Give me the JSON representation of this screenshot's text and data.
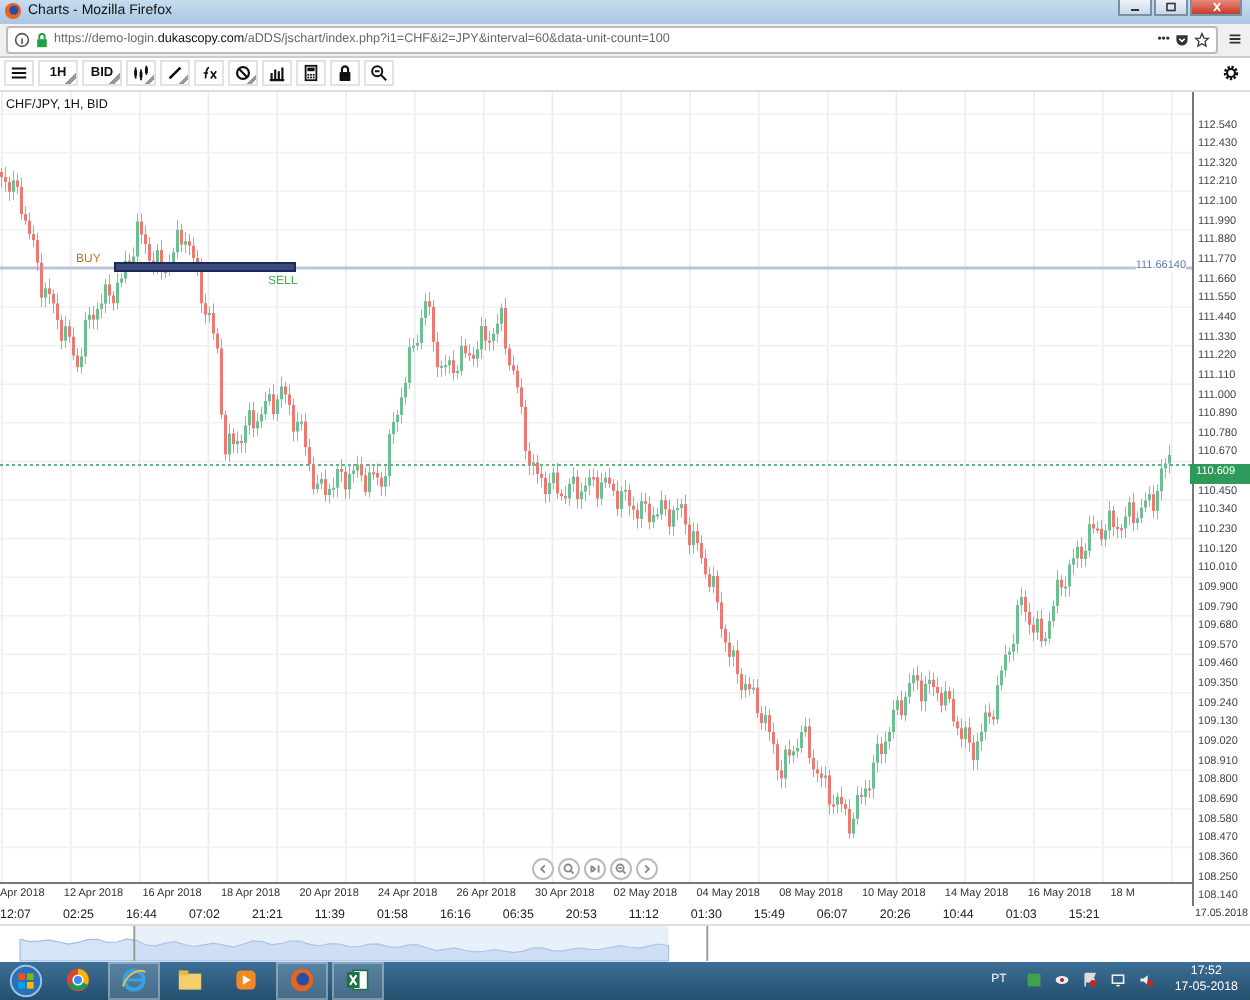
{
  "window": {
    "title": "Charts - Mozilla Firefox"
  },
  "address_bar": {
    "url": "https://demo-login.**dukascopy.com**/aDDS/jschart/index.php?i1=CHF&i2=JPY&interval=60&data-unit-count=100",
    "menu": "•••"
  },
  "toolbar": {
    "timeframe": "1H",
    "price_side": "BID"
  },
  "chart": {
    "title": "CHF/JPY, 1H, BID",
    "price_labels": [
      "112.540",
      "112.430",
      "112.320",
      "112.210",
      "112.100",
      "111.990",
      "111.880",
      "111.770",
      "111.660",
      "111.550",
      "111.440",
      "111.330",
      "111.220",
      "111.110",
      "111.000",
      "110.890",
      "110.780",
      "110.670",
      "110.450",
      "110.340",
      "110.230",
      "110.120",
      "110.010",
      "109.900",
      "109.790",
      "109.680",
      "109.570",
      "109.460",
      "109.350",
      "109.240",
      "109.130",
      "109.020",
      "108.910",
      "108.800",
      "108.690",
      "108.580",
      "108.470",
      "108.360",
      "108.250",
      "108.140"
    ],
    "current_price": "110.609",
    "level_label": "111.66140",
    "buy_label": "BUY",
    "sell_label": "SELL",
    "date_labels": [
      "Apr 2018",
      "12 Apr 2018",
      "16 Apr 2018",
      "18 Apr 2018",
      "20 Apr 2018",
      "24 Apr 2018",
      "26 Apr 2018",
      "30 Apr 2018",
      "02 May 2018",
      "04 May 2018",
      "08 May 2018",
      "10 May 2018",
      "14 May 2018",
      "16 May 2018",
      "18 M"
    ],
    "time_labels": [
      "12:07",
      "02:25",
      "16:44",
      "07:02",
      "21:21",
      "11:39",
      "01:58",
      "16:16",
      "06:35",
      "20:53",
      "11:12",
      "01:30",
      "15:49",
      "06:07",
      "20:26",
      "10:44",
      "01:03",
      "15:21"
    ],
    "end_date": "17.05.2018"
  },
  "taskbar": {
    "language": "PT",
    "time": "17:52",
    "date": "17-05-2018"
  }
}
